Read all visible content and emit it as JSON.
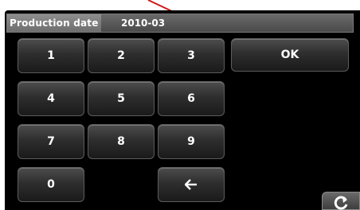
{
  "header": {
    "label": "Production date",
    "value": "2010-03"
  },
  "keypad": {
    "keys": [
      "1",
      "2",
      "3",
      "4",
      "5",
      "6",
      "7",
      "8",
      "9",
      "0"
    ],
    "backspace_icon": "left-arrow-icon",
    "ok_label": "OK"
  },
  "corner_icon": "refresh-icon",
  "colors": {
    "background": "#000000",
    "key_text": "#ffffff",
    "header_bar": "#5a5a5a",
    "annotation_line": "#cc1a1a"
  }
}
